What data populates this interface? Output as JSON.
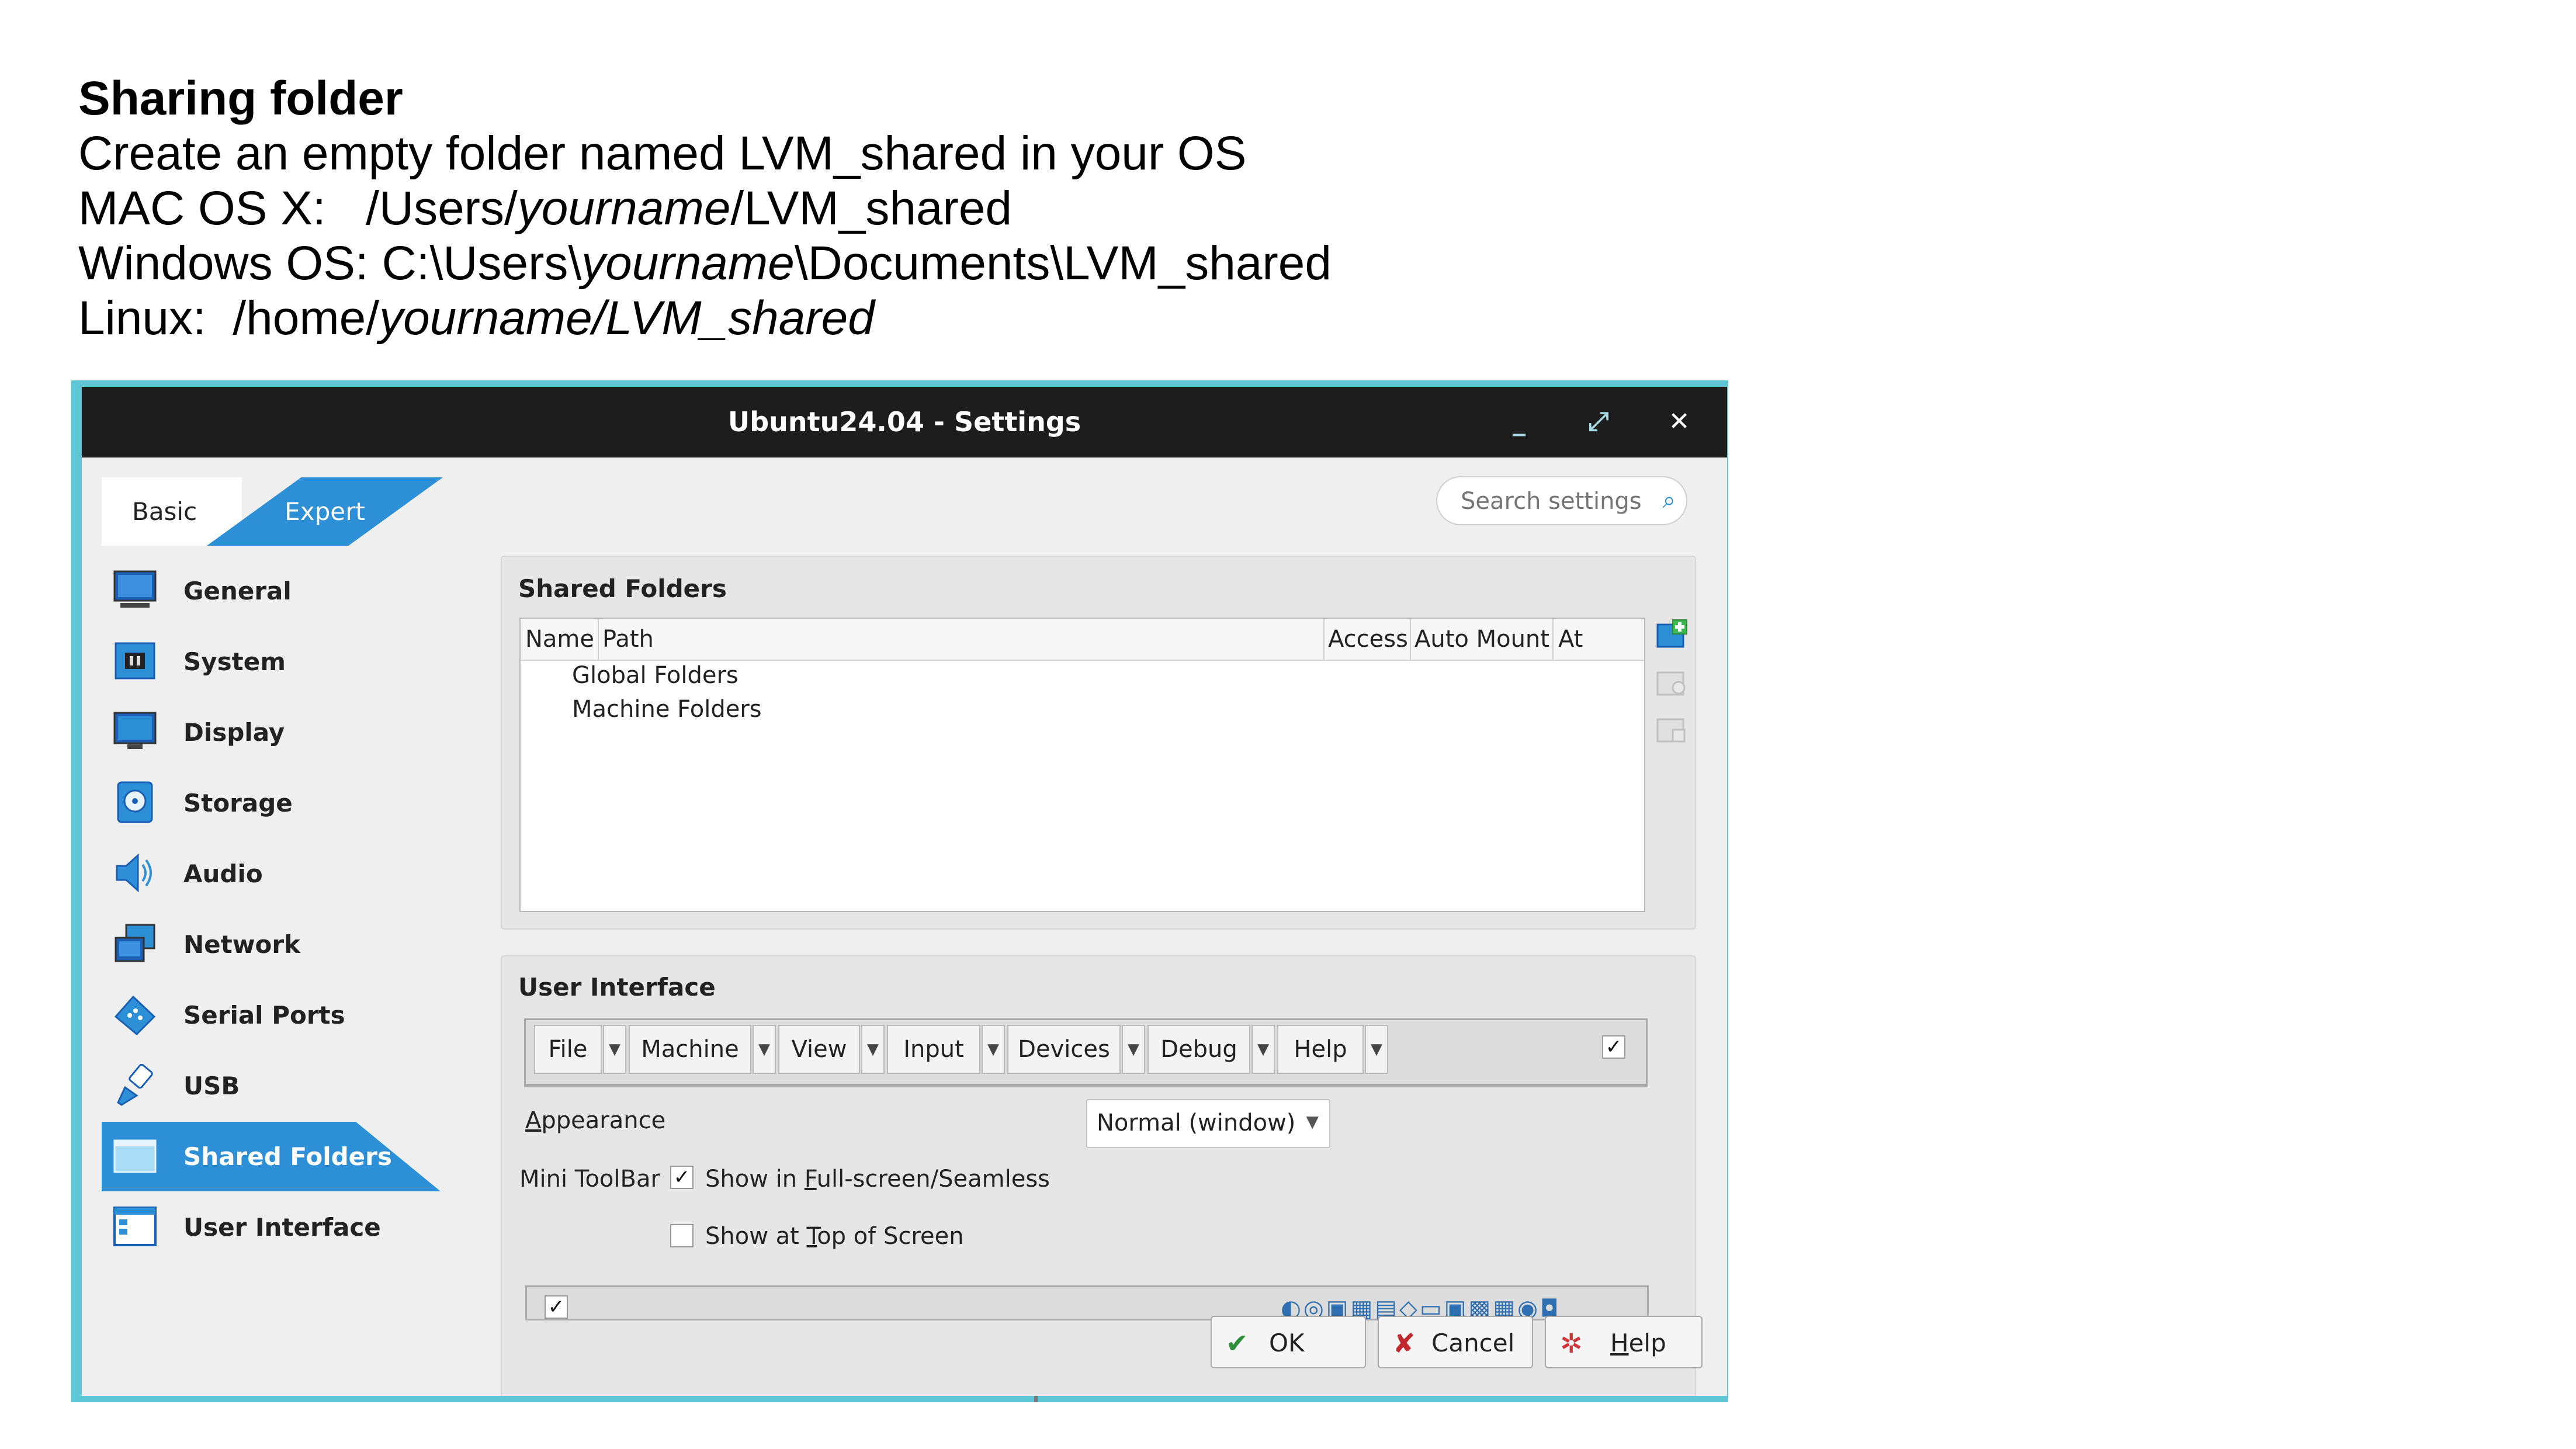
{
  "slide": {
    "title": "Sharing folder",
    "line1": "Create an empty folder named LVM_shared in your OS",
    "mac_prefix": "MAC OS X:   /Users/",
    "mac_italic": "yourname",
    "mac_suffix": "/LVM_shared",
    "win_prefix": "Windows OS: C:\\Users\\",
    "win_italic": "yourname",
    "win_suffix": "\\Documents\\LVM_shared",
    "linux_prefix": "Linux:  /home/",
    "linux_italic": "yourname/LVM_shared"
  },
  "window": {
    "title": "Ubuntu24.04 - Settings",
    "minimize_glyph": "_",
    "maximize_glyph": "⤢",
    "close_glyph": "✕"
  },
  "mode_tabs": {
    "basic": "Basic",
    "expert": "Expert"
  },
  "search": {
    "placeholder": "Search settings",
    "icon": "search-icon"
  },
  "sidebar": {
    "items": [
      {
        "label": "General",
        "icon": "general-monitor-icon"
      },
      {
        "label": "System",
        "icon": "system-chip-icon"
      },
      {
        "label": "Display",
        "icon": "display-monitor-icon"
      },
      {
        "label": "Storage",
        "icon": "storage-disk-icon"
      },
      {
        "label": "Audio",
        "icon": "audio-speaker-icon"
      },
      {
        "label": "Network",
        "icon": "network-icon"
      },
      {
        "label": "Serial Ports",
        "icon": "serial-port-icon"
      },
      {
        "label": "USB",
        "icon": "usb-icon"
      },
      {
        "label": "Shared Folders",
        "icon": "shared-folder-icon",
        "active": true
      },
      {
        "label": "User Interface",
        "icon": "user-interface-icon"
      }
    ]
  },
  "shared_folders": {
    "title": "Shared Folders",
    "columns": [
      "Name",
      "Path",
      "Access",
      "Auto Mount",
      "At"
    ],
    "rows": [
      "Global Folders",
      "Machine Folders"
    ],
    "buttons": [
      "add-shared-folder-icon",
      "edit-shared-folder-icon",
      "remove-shared-folder-icon"
    ]
  },
  "user_interface": {
    "title": "User Interface",
    "menus": [
      "File",
      "Machine",
      "View",
      "Input",
      "Devices",
      "Debug",
      "Help"
    ],
    "menubar_checked": true,
    "appearance_label_u": "A",
    "appearance_label_rest": "ppearance",
    "appearance_value": "Normal (window)",
    "mini_toolbar_label": "Mini ToolBar",
    "show_fullscreen_pre": "Show in ",
    "show_fullscreen_u": "F",
    "show_fullscreen_post": "ull-screen/Seamless",
    "show_fullscreen_checked": true,
    "show_top_pre": "Show at ",
    "show_top_u": "T",
    "show_top_post": "op of Screen",
    "show_top_checked": false,
    "statusbar_checked": true
  },
  "dialog_buttons": {
    "ok": "OK",
    "cancel": "Cancel",
    "help_u": "H",
    "help_rest": "elp"
  },
  "colors": {
    "accent": "#2d8fd6",
    "titlebar": "#1d1d1d",
    "frame": "#5fc6d6"
  }
}
